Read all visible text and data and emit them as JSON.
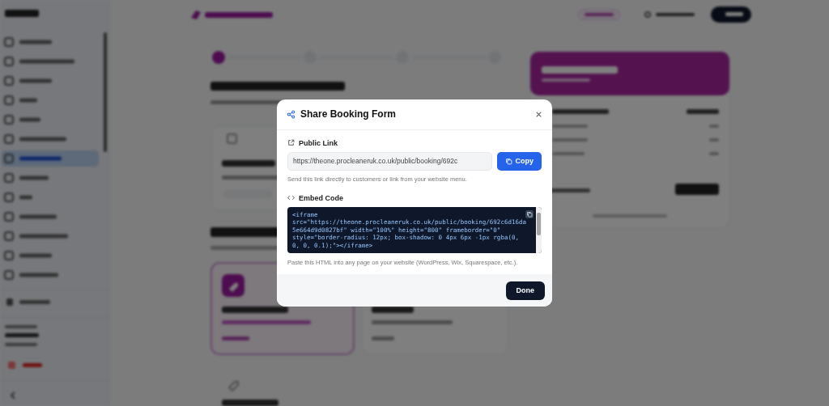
{
  "dialog": {
    "title": "Share Booking Form",
    "link_label": "Public Link",
    "link_value": "https://theone.procleaneruk.co.uk/public/booking/692c",
    "copy": "Copy",
    "link_help": "Send this link directly to customers or link from your website menu.",
    "embed_label": "Embed Code",
    "embed_code": "<iframe\nsrc=\"https://theone.procleaneruk.co.uk/public/booking/692c6d16da\n5e664d9d0827bf\" width=\"100%\" height=\"800\" frameborder=\"0\"\nstyle=\"border-radius: 12px; box-shadow: 0 4px 6px -1px rgba(0,\n0, 0, 0.1);\"></iframe>",
    "embed_help": "Paste this HTML into any page on your website (WordPress, Wix, Squarespace, etc.).",
    "done": "Done"
  }
}
